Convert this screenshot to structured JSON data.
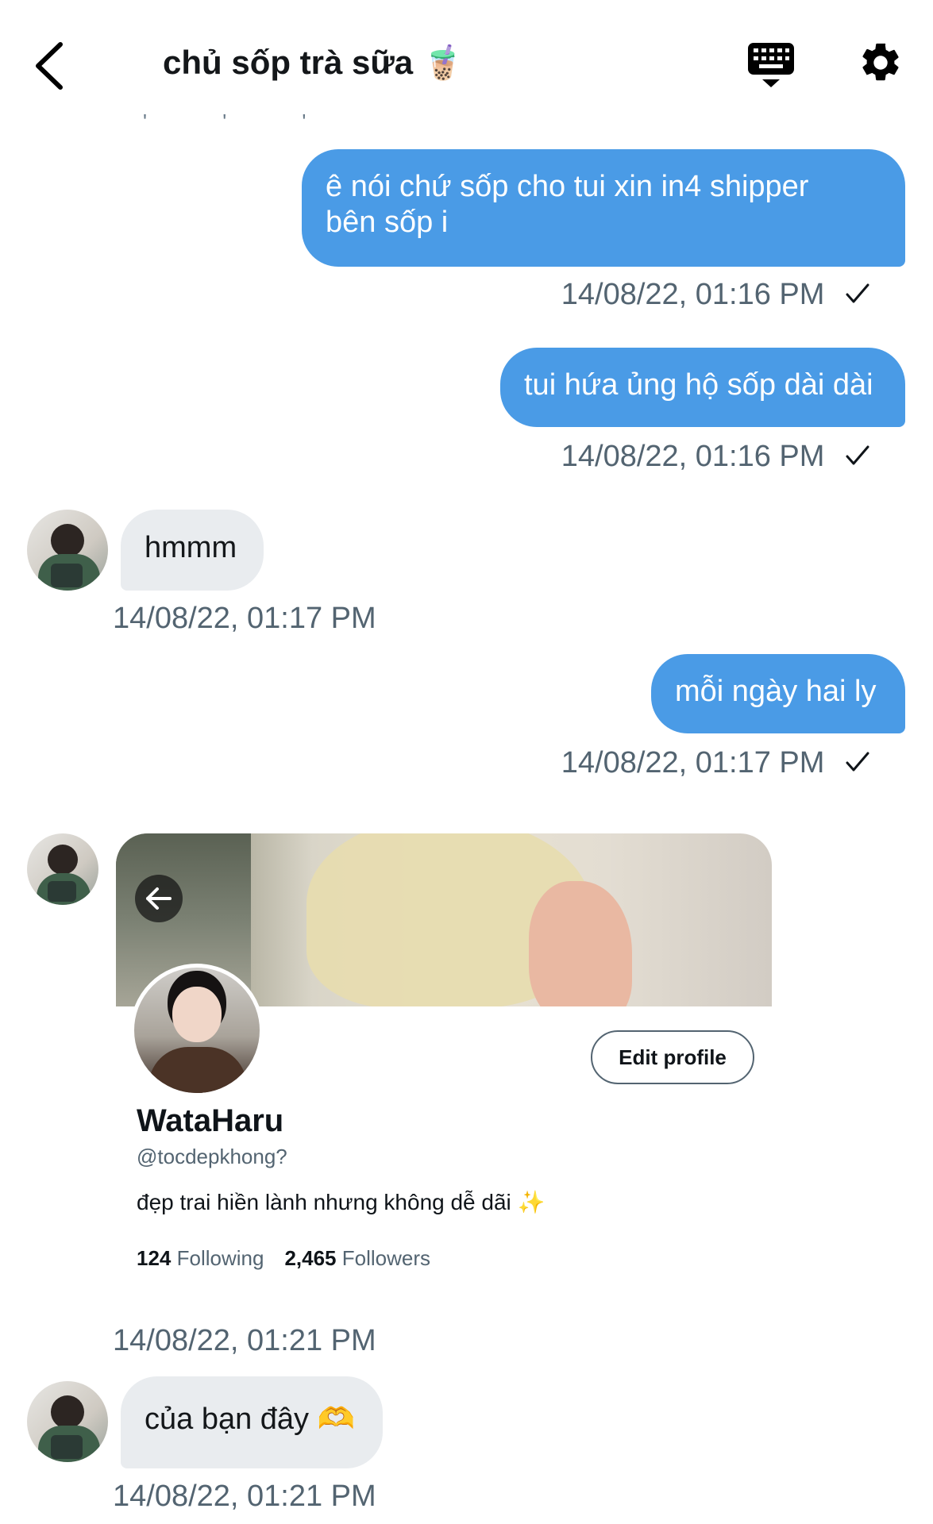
{
  "header": {
    "title": "chủ sốp trà sữa 🧋",
    "ghost_ticks": "' ' '"
  },
  "messages": [
    {
      "direction": "out",
      "text_line1": "ê nói chứ sốp cho tui xin in4 shipper",
      "text_line2": "bên sốp i",
      "timestamp": "14/08/22, 01:16 PM"
    },
    {
      "direction": "out",
      "text": "tui hứa ủng hộ sốp dài dài",
      "timestamp": "14/08/22, 01:16 PM"
    },
    {
      "direction": "in",
      "text": "hmmm",
      "timestamp": "14/08/22, 01:17 PM"
    },
    {
      "direction": "out",
      "text": "mỗi ngày hai ly",
      "timestamp": "14/08/22, 01:17 PM"
    },
    {
      "direction": "in",
      "type": "profile_card",
      "timestamp": "14/08/22, 01:21 PM"
    },
    {
      "direction": "in",
      "text": "của bạn đây 🫶",
      "timestamp": "14/08/22, 01:21 PM"
    }
  ],
  "profile_card": {
    "name": "WataHaru",
    "handle": "@tocdepkhong?",
    "bio": "đẹp trai hiền lành nhưng không dễ dãi ✨",
    "following_count": "124",
    "following_label": "Following",
    "followers_count": "2,465",
    "followers_label": "Followers",
    "edit_button": "Edit profile"
  },
  "colors": {
    "outgoing_bubble": "#4a9be6",
    "incoming_bubble": "#e9ecef",
    "timestamp": "#536471"
  },
  "icons": [
    "back-arrow-icon",
    "keyboard-icon",
    "gear-icon",
    "checkmark-icon",
    "arrow-left-icon"
  ]
}
